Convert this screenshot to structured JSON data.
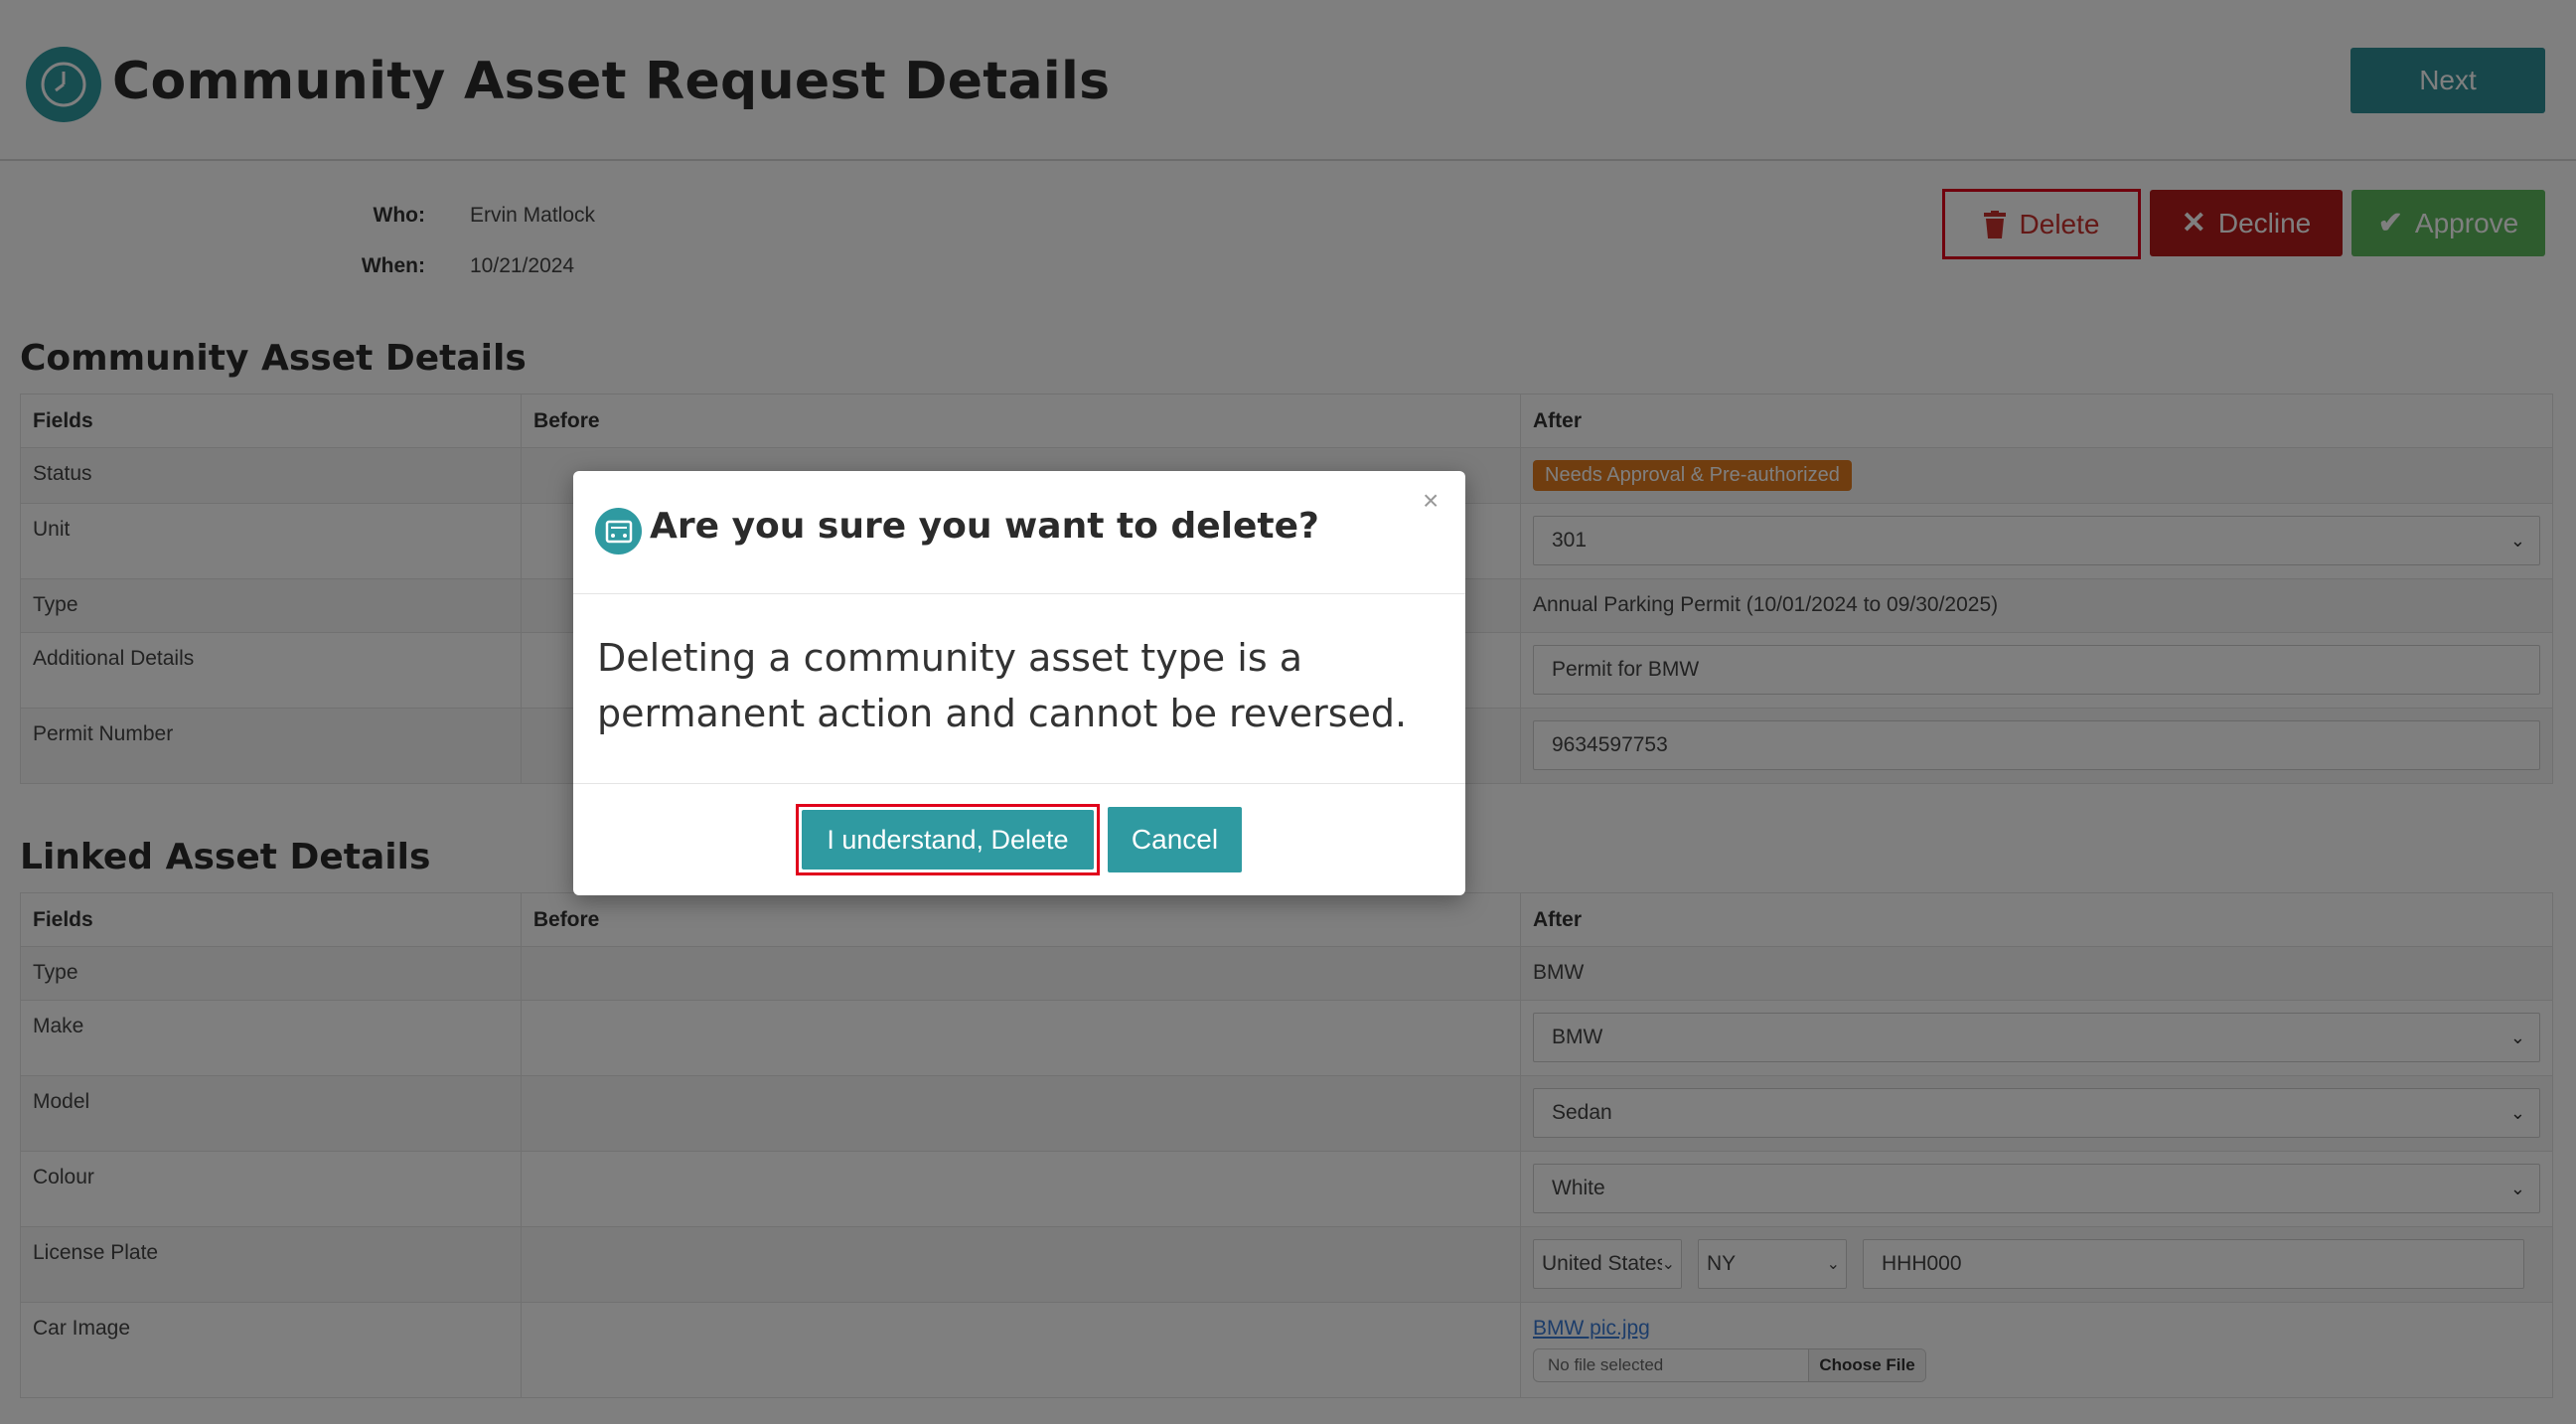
{
  "header": {
    "title": "Community Asset Request Details",
    "next_label": "Next"
  },
  "meta": {
    "who_label": "Who:",
    "who_value": "Ervin Matlock",
    "when_label": "When:",
    "when_value": "10/21/2024"
  },
  "actions": {
    "delete_label": "Delete",
    "decline_label": "Decline",
    "approve_label": "Approve"
  },
  "asset_section": {
    "title": "Community Asset Details",
    "headers": [
      "Fields",
      "Before",
      "After"
    ],
    "status_label": "Status",
    "status_badge": "Needs Approval & Pre-authorized",
    "unit_label": "Unit",
    "unit_value": "301",
    "type_label": "Type",
    "type_value": "Annual Parking Permit (10/01/2024 to 09/30/2025)",
    "details_label": "Additional Details",
    "details_value": "Permit for BMW",
    "permit_label": "Permit Number",
    "permit_value": "9634597753"
  },
  "linked_section": {
    "title": "Linked Asset Details",
    "headers": [
      "Fields",
      "Before",
      "After"
    ],
    "type_label": "Type",
    "type_value": "BMW",
    "make_label": "Make",
    "make_value": "BMW",
    "model_label": "Model",
    "model_value": "Sedan",
    "colour_label": "Colour",
    "colour_value": "White",
    "plate_label": "License Plate",
    "plate_country": "United States",
    "plate_state": "NY",
    "plate_value": "HHH000",
    "image_label": "Car Image",
    "image_link": "BMW pic.jpg",
    "file_placeholder": "No file selected",
    "file_button": "Choose File"
  },
  "modal": {
    "title": "Are you sure you want to delete?",
    "close": "×",
    "body": "Deleting a community asset type is a permanent action and cannot be reversed.",
    "confirm_label": "I understand, Delete",
    "cancel_label": "Cancel"
  },
  "colors": {
    "teal": "#2f9aa1",
    "decline": "#b51b1b",
    "approve": "#5cb85c",
    "badge": "#e07b1f",
    "highlight": "#e0001b"
  }
}
